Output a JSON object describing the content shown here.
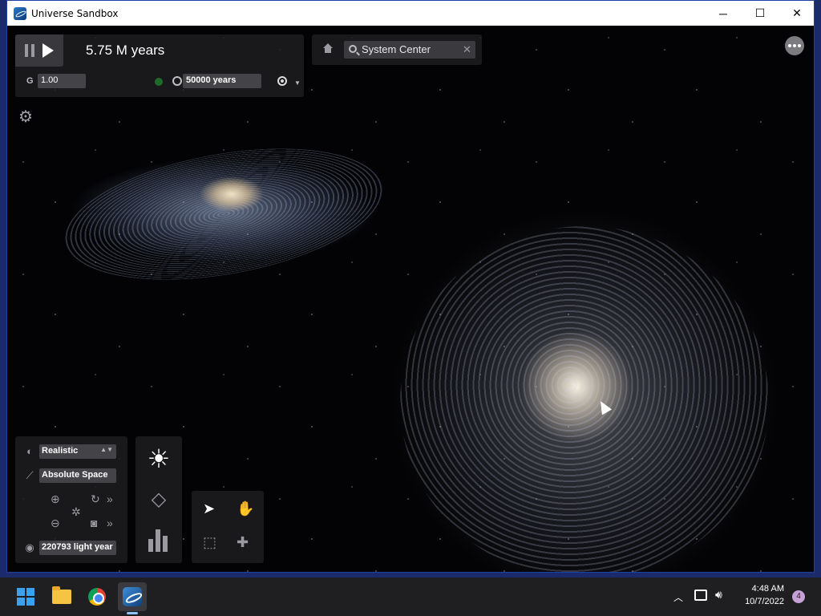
{
  "window": {
    "title": "Universe Sandbox",
    "controls": {
      "minimize": "─",
      "maximize": "☐",
      "close": "✕"
    }
  },
  "simulation": {
    "time": "5.75 M years",
    "gravity_label": "G",
    "gravity_value": "1.00",
    "timestep": "50000 years",
    "focus_search": "System Center",
    "status_color": "#1f6b2a"
  },
  "view": {
    "render_mode": "Realistic",
    "space_mode": "Absolute Space",
    "distance": "220793 light year"
  },
  "icons": {
    "settings": "gear-icon",
    "menu": "more-icon",
    "home": "home-icon",
    "search": "search-icon",
    "sun": "sun-icon",
    "grid": "grid-icon",
    "stats": "bar-chart-icon",
    "select": "cursor-icon",
    "grab": "hand-icon",
    "box_select": "box-select-icon",
    "add_object": "add-object-icon"
  },
  "taskbar": {
    "apps": [
      "Start",
      "File Explorer",
      "Google Chrome",
      "Universe Sandbox"
    ],
    "time": "4:48 AM",
    "date": "10/7/2022",
    "notifications": "4"
  },
  "colors": {
    "accent": "#3aa0f0",
    "panel_bg": "#1e1e22",
    "window_border": "#1e3fa8"
  }
}
